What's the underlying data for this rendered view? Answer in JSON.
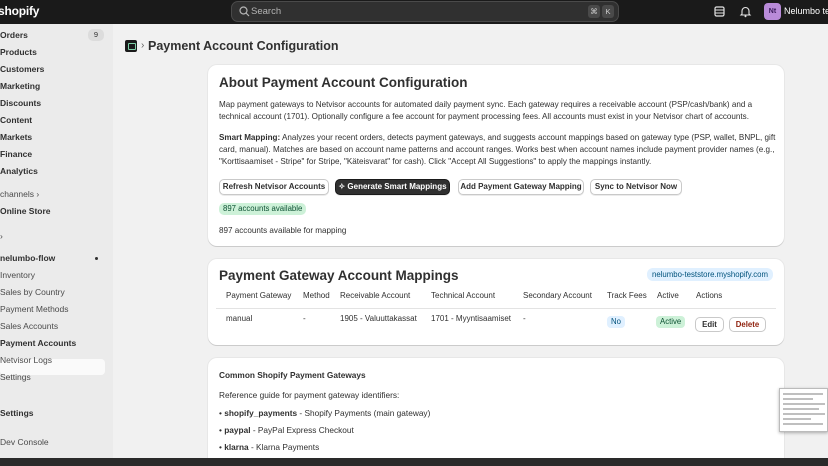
{
  "topbar": {
    "logo": "shopify",
    "search_placeholder": "Search",
    "shortcut_keys": [
      "⌘",
      "K"
    ],
    "avatar_initials": "Nt",
    "store_name": "Nelumbo tes"
  },
  "sidebar": {
    "items": [
      {
        "label": "Orders",
        "badge": "9"
      },
      {
        "label": "Products"
      },
      {
        "label": "Customers"
      },
      {
        "label": "Marketing"
      },
      {
        "label": "Discounts"
      },
      {
        "label": "Content"
      },
      {
        "label": "Markets"
      },
      {
        "label": "Finance"
      },
      {
        "label": "Analytics"
      }
    ],
    "channels_label": "channels",
    "online_store": "Online Store",
    "apps_chevron": "›",
    "app_name": "nelumbo-flow",
    "app_items": [
      "Inventory",
      "Sales by Country",
      "Payment Methods",
      "Sales Accounts",
      "Payment Accounts",
      "Netvisor Logs",
      "Settings"
    ],
    "settings": "Settings",
    "dev_console": "Dev Console"
  },
  "header": {
    "separator": "›",
    "title": "Payment Account Configuration"
  },
  "about": {
    "title": "About Payment Account Configuration",
    "description": "Map payment gateways to Netvisor accounts for automated daily payment sync. Each gateway requires a receivable account (PSP/cash/bank) and a technical account (1701). Optionally configure a fee account for payment processing fees. All accounts must exist in your Netvisor chart of accounts.",
    "smart_label": "Smart Mapping:",
    "smart_text": " Analyzes your recent orders, detects payment gateways, and suggests account mappings based on gateway type (PSP, wallet, BNPL, gift card, manual). Matches are based on account name patterns and account ranges. Works best when account names include payment provider names (e.g., \"Korttisaamiset - Stripe\" for Stripe, \"Käteisvarat\" for cash). Click \"Accept All Suggestions\" to apply the mappings instantly.",
    "buttons": {
      "refresh": "Refresh Netvisor Accounts",
      "generate": "Generate Smart Mappings",
      "add": "Add Payment Gateway Mapping",
      "sync": "Sync to Netvisor Now"
    },
    "accounts_badge": "897 accounts available",
    "accounts_text": "897 accounts available for mapping"
  },
  "mappings": {
    "title": "Payment Gateway Account Mappings",
    "store_pill": "nelumbo-teststore.myshopify.com",
    "columns": [
      "Payment Gateway",
      "Method",
      "Receivable Account",
      "Technical Account",
      "Secondary Account",
      "Track Fees",
      "Active",
      "Actions"
    ],
    "row": {
      "gateway": "manual",
      "method": "-",
      "receivable": "1905 - Valuuttakassat",
      "technical": "1701 - Myyntisaamiset",
      "secondary": "-",
      "track_fees": "No",
      "active": "Active",
      "edit": "Edit",
      "delete": "Delete"
    }
  },
  "common": {
    "title": "Common Shopify Payment Gateways",
    "intro": "Reference guide for payment gateway identifiers:",
    "items": [
      {
        "key": "shopify_payments",
        "desc": " - Shopify Payments (main gateway)"
      },
      {
        "key": "paypal",
        "desc": " - PayPal Express Checkout"
      },
      {
        "key": "klarna",
        "desc": " - Klarna Payments"
      }
    ]
  },
  "colors": {
    "topbar": "#1a1a1a",
    "primary_button": "#303030",
    "success_badge": "#cdf1d8",
    "info_badge": "#e0f0ff",
    "delete_text": "#8e1f0b"
  }
}
